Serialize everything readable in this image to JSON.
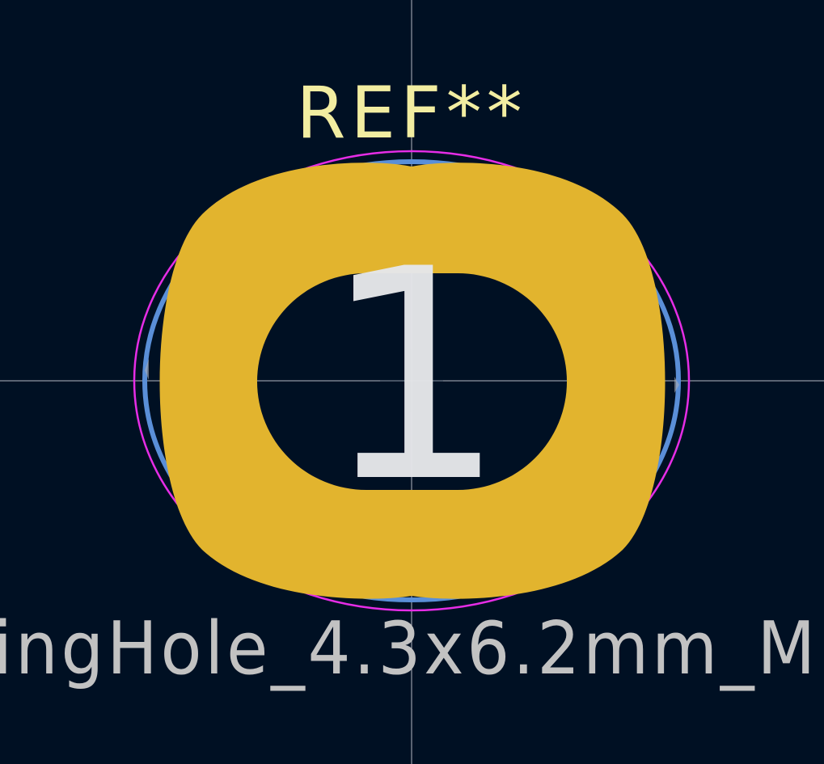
{
  "footprint": {
    "reference": "REF**",
    "value": "ingHole_4.3x6.2mm_M",
    "pad_number": "1"
  },
  "colors": {
    "background": "#001023",
    "pad_copper": "#E2B42E",
    "courtyard": "#E62DE6",
    "fab_outline": "#5A8FD8",
    "reference_text": "#F2EDA1",
    "value_text": "#C2C2C2",
    "pad_number_text": "#E6E7EA",
    "crosshair": "#C8C8D2"
  }
}
